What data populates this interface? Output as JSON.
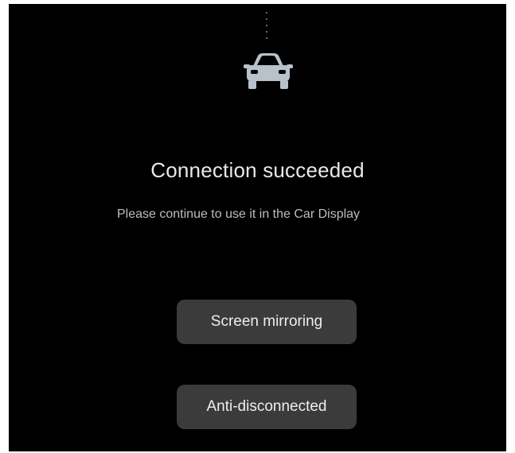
{
  "status": {
    "icon": "car-icon",
    "title": "Connection succeeded",
    "message": "Please continue to use it in the Car Display"
  },
  "actions": {
    "screen_mirroring_label": "Screen mirroring",
    "anti_disconnected_label": "Anti-disconnected"
  },
  "colors": {
    "background": "#000000",
    "button": "#3b3b3b",
    "icon": "#b9c2ca"
  }
}
